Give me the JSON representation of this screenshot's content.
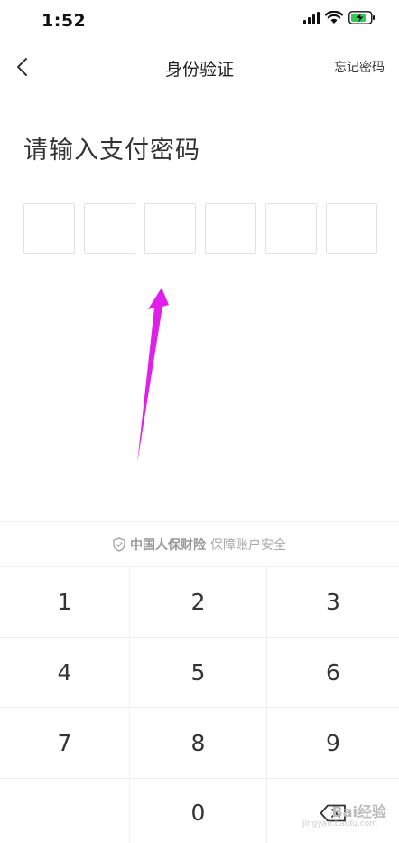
{
  "status_bar": {
    "time": "1:52"
  },
  "nav": {
    "title": "身份验证",
    "forgot_label": "忘记密码"
  },
  "prompt": {
    "title": "请输入支付密码"
  },
  "pin": {
    "length": 6
  },
  "security": {
    "brand": "中国人保财险",
    "text": "保障账户安全"
  },
  "keypad": {
    "keys": [
      "1",
      "2",
      "3",
      "4",
      "5",
      "6",
      "7",
      "8",
      "9",
      "",
      "0",
      "delete"
    ]
  },
  "watermark": {
    "text": "Bai经验",
    "sub": "jingyan.baidu.com"
  },
  "colors": {
    "annotation_arrow": "#e020e8"
  }
}
